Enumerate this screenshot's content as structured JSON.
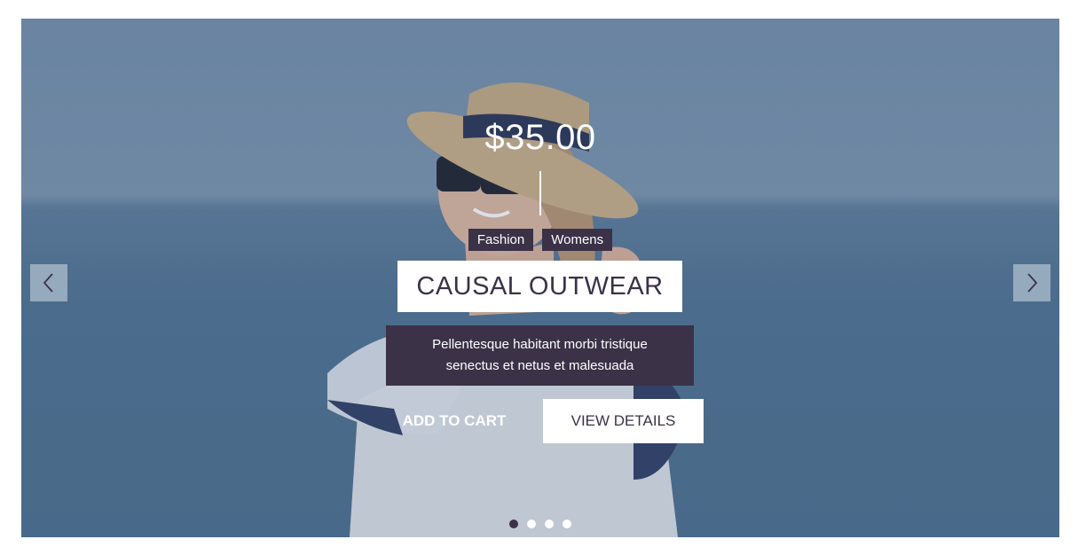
{
  "slide": {
    "price": "$35.00",
    "tags": [
      "Fashion",
      "Womens"
    ],
    "title": "CAUSAL OUTWEAR",
    "description_line1": "Pellentesque habitant morbi tristique",
    "description_line2": "senectus et netus et malesuada",
    "add_to_cart_label": "ADD TO CART",
    "view_details_label": "VIEW DETAILS"
  },
  "carousel": {
    "prev_icon": "chevron-left-icon",
    "next_icon": "chevron-right-icon",
    "slide_count": 4,
    "active_index": 0
  },
  "colors": {
    "accent": "#3b3247",
    "button_bg": "#ffffff",
    "sky": "#7491ad",
    "sea": "#4f7393"
  }
}
